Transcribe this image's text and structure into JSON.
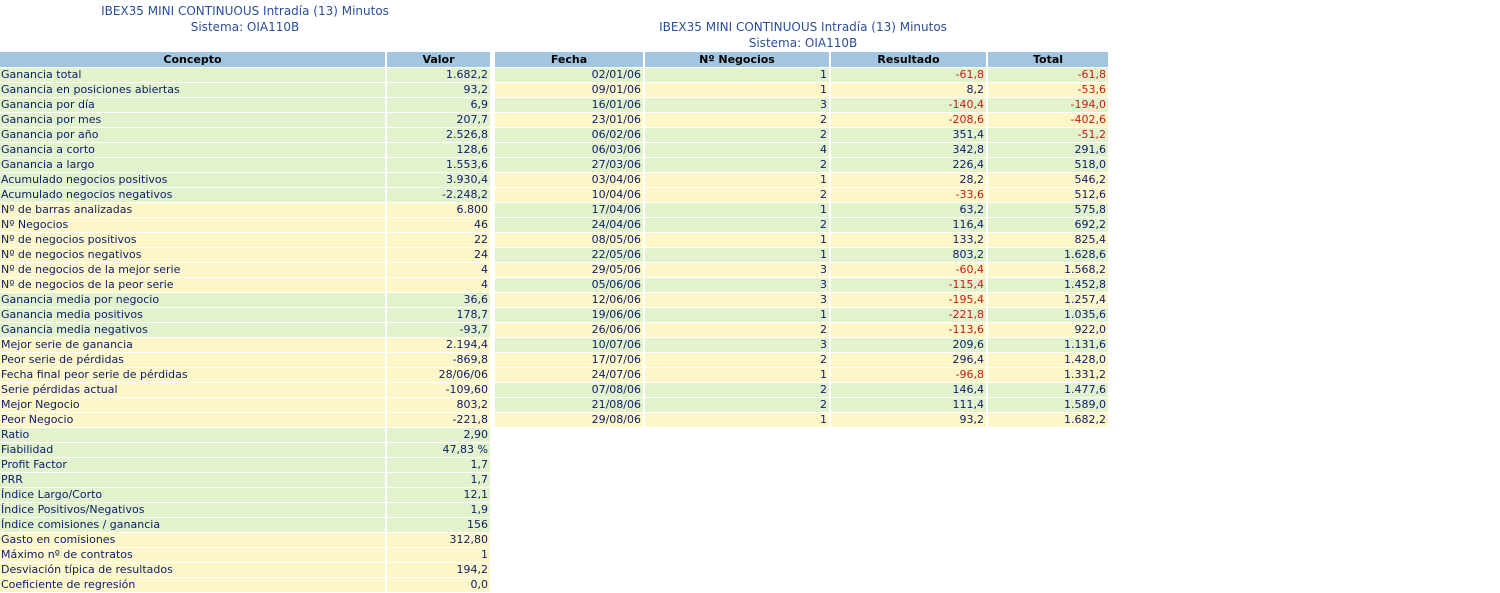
{
  "left_header": {
    "line1": "IBEX35 MINI CONTINUOUS Intradía (13) Minutos",
    "line2": "Sistema: OIA110B"
  },
  "right_header": {
    "line1": "IBEX35 MINI CONTINUOUS Intradía (13) Minutos",
    "line2": "Sistema: OIA110B"
  },
  "summary": {
    "columns": [
      "Concepto",
      "Valor"
    ],
    "rows": [
      {
        "concepto": "Ganancia total",
        "valor": "1.682,2",
        "band": "green"
      },
      {
        "concepto": "Ganancia en posiciones abiertas",
        "valor": "93,2",
        "band": "green"
      },
      {
        "concepto": "Ganancia por día",
        "valor": "6,9",
        "band": "green"
      },
      {
        "concepto": "Ganancia por mes",
        "valor": "207,7",
        "band": "green"
      },
      {
        "concepto": "Ganancia por año",
        "valor": "2.526,8",
        "band": "green"
      },
      {
        "concepto": "Ganancia a corto",
        "valor": "128,6",
        "band": "green"
      },
      {
        "concepto": "Ganancia a largo",
        "valor": "1.553,6",
        "band": "green"
      },
      {
        "concepto": "Acumulado negocios positivos",
        "valor": "3.930,4",
        "band": "green"
      },
      {
        "concepto": "Acumulado negocios negativos",
        "valor": "-2.248,2",
        "band": "green"
      },
      {
        "concepto": "Nº de barras analizadas",
        "valor": "6.800",
        "band": "yellow"
      },
      {
        "concepto": "Nº Negocios",
        "valor": "46",
        "band": "yellow"
      },
      {
        "concepto": "Nº de negocios positivos",
        "valor": "22",
        "band": "yellow"
      },
      {
        "concepto": "Nº de negocios negativos",
        "valor": "24",
        "band": "yellow"
      },
      {
        "concepto": "Nº de negocios de la mejor serie",
        "valor": "4",
        "band": "yellow"
      },
      {
        "concepto": "Nº de negocios de la peor serie",
        "valor": "4",
        "band": "yellow"
      },
      {
        "concepto": "Ganancia media por negocio",
        "valor": "36,6",
        "band": "green"
      },
      {
        "concepto": "Ganancia media positivos",
        "valor": "178,7",
        "band": "green"
      },
      {
        "concepto": "Ganancia media negativos",
        "valor": "-93,7",
        "band": "green"
      },
      {
        "concepto": "Mejor serie de ganancia",
        "valor": "2.194,4",
        "band": "yellow"
      },
      {
        "concepto": "Peor serie de pérdidas",
        "valor": "-869,8",
        "band": "yellow"
      },
      {
        "concepto": "Fecha final peor serie de pérdidas",
        "valor": "28/06/06",
        "band": "yellow"
      },
      {
        "concepto": "Serie pérdidas actual",
        "valor": "-109,60",
        "band": "yellow"
      },
      {
        "concepto": "Mejor Negocio",
        "valor": "803,2",
        "band": "yellow"
      },
      {
        "concepto": "Peor Negocio",
        "valor": "-221,8",
        "band": "yellow"
      },
      {
        "concepto": "Ratio",
        "valor": "2,90",
        "band": "green"
      },
      {
        "concepto": "Fiabilidad",
        "valor": "47,83 %",
        "band": "green"
      },
      {
        "concepto": "Profit Factor",
        "valor": "1,7",
        "band": "green"
      },
      {
        "concepto": "PRR",
        "valor": "1,7",
        "band": "green"
      },
      {
        "concepto": "Índice Largo/Corto",
        "valor": "12,1",
        "band": "green"
      },
      {
        "concepto": "Índice Positivos/Negativos",
        "valor": "1,9",
        "band": "green"
      },
      {
        "concepto": "Índice comisiones / ganancia",
        "valor": "156",
        "band": "green"
      },
      {
        "concepto": "Gasto en comisiones",
        "valor": "312,80",
        "band": "yellow"
      },
      {
        "concepto": "Máximo nº de contratos",
        "valor": "1",
        "band": "yellow"
      },
      {
        "concepto": "Desviación típica de resultados",
        "valor": "194,2",
        "band": "yellow"
      },
      {
        "concepto": "Coeficiente de regresión",
        "valor": "0,0",
        "band": "yellow"
      }
    ]
  },
  "trades": {
    "columns": [
      "Fecha",
      "Nº Negocios",
      "Resultado",
      "Total"
    ],
    "rows": [
      {
        "fecha": "02/01/06",
        "negocios": "1",
        "resultado": "-61,8",
        "total": "-61,8",
        "band": "green"
      },
      {
        "fecha": "09/01/06",
        "negocios": "1",
        "resultado": "8,2",
        "total": "-53,6",
        "band": "yellow"
      },
      {
        "fecha": "16/01/06",
        "negocios": "3",
        "resultado": "-140,4",
        "total": "-194,0",
        "band": "green"
      },
      {
        "fecha": "23/01/06",
        "negocios": "2",
        "resultado": "-208,6",
        "total": "-402,6",
        "band": "yellow"
      },
      {
        "fecha": "06/02/06",
        "negocios": "2",
        "resultado": "351,4",
        "total": "-51,2",
        "band": "green"
      },
      {
        "fecha": "06/03/06",
        "negocios": "4",
        "resultado": "342,8",
        "total": "291,6",
        "band": "green"
      },
      {
        "fecha": "27/03/06",
        "negocios": "2",
        "resultado": "226,4",
        "total": "518,0",
        "band": "green"
      },
      {
        "fecha": "03/04/06",
        "negocios": "1",
        "resultado": "28,2",
        "total": "546,2",
        "band": "yellow"
      },
      {
        "fecha": "10/04/06",
        "negocios": "2",
        "resultado": "-33,6",
        "total": "512,6",
        "band": "yellow"
      },
      {
        "fecha": "17/04/06",
        "negocios": "1",
        "resultado": "63,2",
        "total": "575,8",
        "band": "green"
      },
      {
        "fecha": "24/04/06",
        "negocios": "2",
        "resultado": "116,4",
        "total": "692,2",
        "band": "green"
      },
      {
        "fecha": "08/05/06",
        "negocios": "1",
        "resultado": "133,2",
        "total": "825,4",
        "band": "yellow"
      },
      {
        "fecha": "22/05/06",
        "negocios": "1",
        "resultado": "803,2",
        "total": "1.628,6",
        "band": "green"
      },
      {
        "fecha": "29/05/06",
        "negocios": "3",
        "resultado": "-60,4",
        "total": "1.568,2",
        "band": "yellow"
      },
      {
        "fecha": "05/06/06",
        "negocios": "3",
        "resultado": "-115,4",
        "total": "1.452,8",
        "band": "green"
      },
      {
        "fecha": "12/06/06",
        "negocios": "3",
        "resultado": "-195,4",
        "total": "1.257,4",
        "band": "yellow"
      },
      {
        "fecha": "19/06/06",
        "negocios": "1",
        "resultado": "-221,8",
        "total": "1.035,6",
        "band": "green"
      },
      {
        "fecha": "26/06/06",
        "negocios": "2",
        "resultado": "-113,6",
        "total": "922,0",
        "band": "yellow"
      },
      {
        "fecha": "10/07/06",
        "negocios": "3",
        "resultado": "209,6",
        "total": "1.131,6",
        "band": "green"
      },
      {
        "fecha": "17/07/06",
        "negocios": "2",
        "resultado": "296,4",
        "total": "1.428,0",
        "band": "yellow"
      },
      {
        "fecha": "24/07/06",
        "negocios": "1",
        "resultado": "-96,8",
        "total": "1.331,2",
        "band": "yellow"
      },
      {
        "fecha": "07/08/06",
        "negocios": "2",
        "resultado": "146,4",
        "total": "1.477,6",
        "band": "green"
      },
      {
        "fecha": "21/08/06",
        "negocios": "2",
        "resultado": "111,4",
        "total": "1.589,0",
        "band": "green"
      },
      {
        "fecha": "29/08/06",
        "negocios": "1",
        "resultado": "93,2",
        "total": "1.682,2",
        "band": "yellow"
      }
    ]
  },
  "colors": {
    "header_bg": "#a3c6e0",
    "green_row": "#e1f2cc",
    "yellow_row": "#fdf6c8",
    "text": "#0b1d6b",
    "negative": "#c81a1a",
    "title": "#2a4f9a"
  }
}
